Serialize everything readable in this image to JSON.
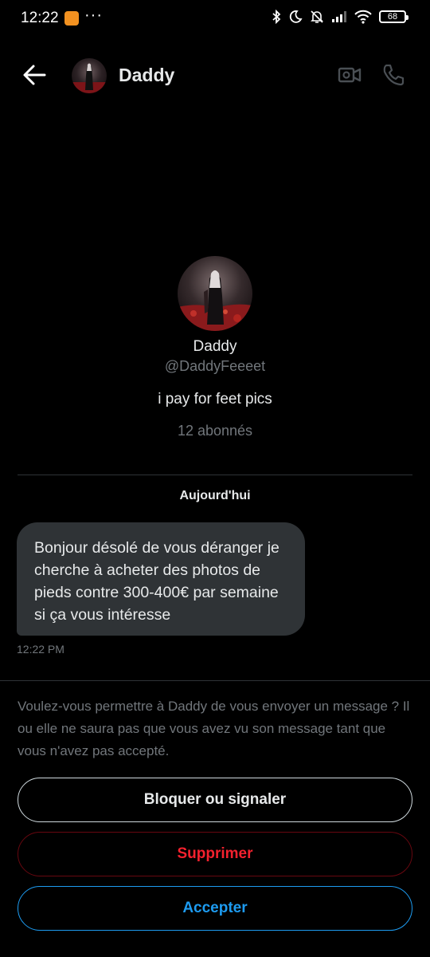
{
  "status_bar": {
    "time": "12:22",
    "dots": "···",
    "battery": "68"
  },
  "header": {
    "name": "Daddy"
  },
  "profile": {
    "name": "Daddy",
    "handle": "@DaddyFeeeet",
    "bio": "i pay for feet pics",
    "followers": "12 abonnés"
  },
  "conversation": {
    "date_separator": "Aujourd'hui",
    "messages": [
      {
        "text": "Bonjour désolé de vous déranger je cherche à acheter des photos de pieds contre 300-400€ par semaine si ça vous intéresse",
        "time": "12:22 PM"
      }
    ]
  },
  "request": {
    "prompt": "Voulez-vous permettre à Daddy de vous envoyer un message ? Il ou elle ne saura pas que vous avez vu son message tant que vous n'avez pas accepté.",
    "block_label": "Bloquer ou signaler",
    "delete_label": "Supprimer",
    "accept_label": "Accepter"
  },
  "colors": {
    "background": "#000000",
    "accent": "#1d9bf0",
    "danger": "#f4212e",
    "bubble": "#2f3336",
    "muted": "#71767b"
  },
  "icons": [
    "back-arrow-icon",
    "video-call-icon",
    "phone-icon",
    "bluetooth-icon",
    "moon-icon",
    "bell-muted-icon",
    "signal-icon",
    "wifi-icon",
    "battery-icon"
  ]
}
